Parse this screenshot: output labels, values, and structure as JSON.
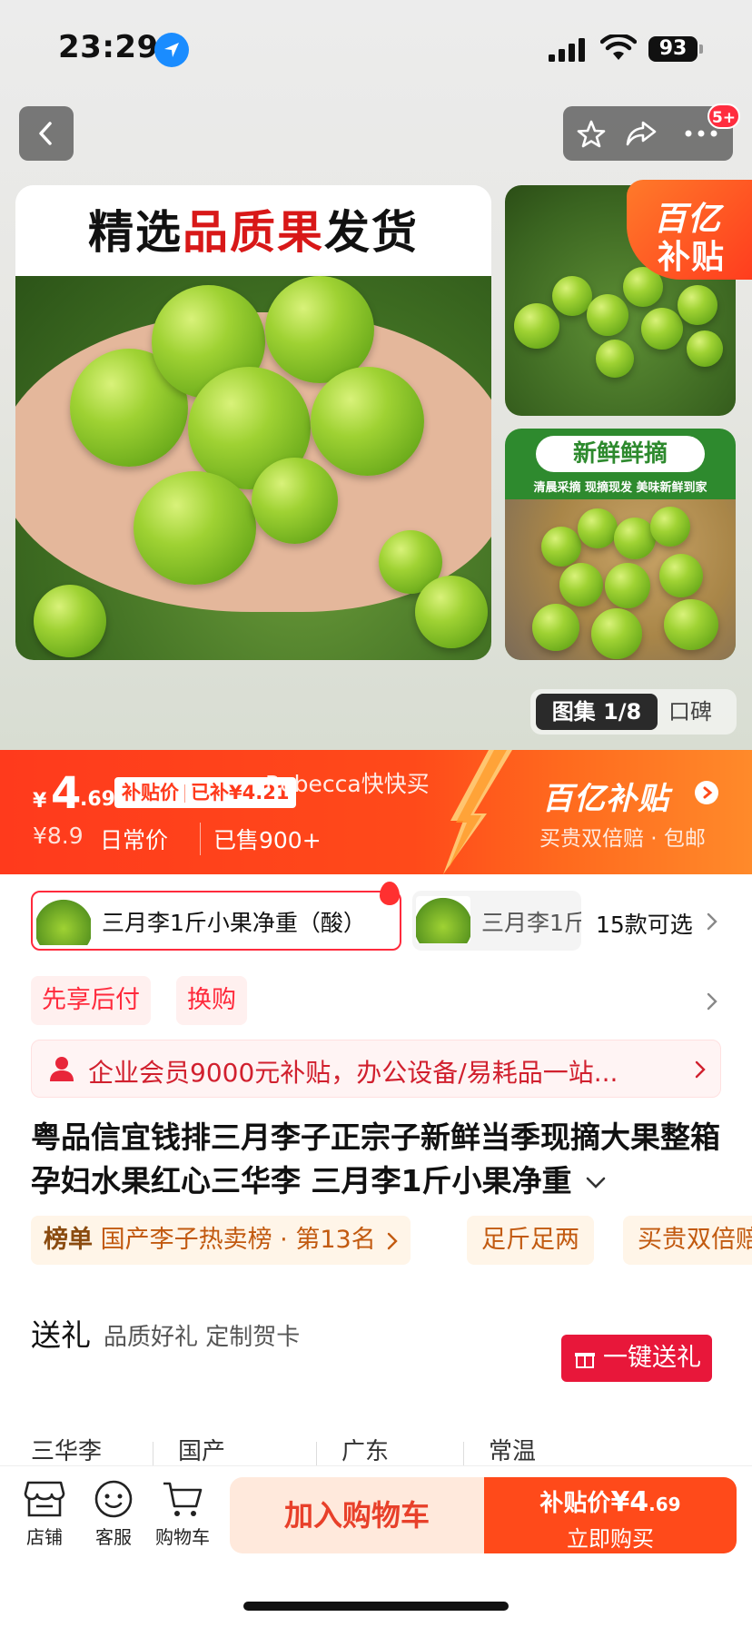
{
  "status_bar": {
    "time": "23:29",
    "battery": "93"
  },
  "header": {
    "notification_badge": "5+"
  },
  "gallery": {
    "main_headline_part1": "精选",
    "main_headline_red": "品质果",
    "main_headline_part2": "发货",
    "corner_tag_line1": "百亿",
    "corner_tag_line2": "补贴",
    "side_pill": "新鲜鲜摘",
    "side_sub": "清晨采摘 现摘现发 美味新鲜到家",
    "counter_active": "图集 1/8",
    "counter_other": "口碑"
  },
  "price": {
    "currency": "¥",
    "big": "4",
    "small": ".69",
    "tag_label": "补贴价",
    "tag_saved": "已补¥4.21",
    "watermark": "Rebecca快快买",
    "original_price": "¥8.9",
    "daily_label": "日常价",
    "sold": "已售900+",
    "brand": "百亿补贴",
    "brand_sub": "买贵双倍赔 · 包邮"
  },
  "variants": {
    "selected": "三月李1斤小果净重（酸）",
    "second": "三月李1斤",
    "count": "15款可选"
  },
  "tags": [
    "先享后付",
    "换购"
  ],
  "member_bar": {
    "text": "企业会员9000元补贴，办公设备/易耗品一站..."
  },
  "title": "粤品信宜钱排三月李子正宗子新鲜当季现摘大果整箱孕妇水果红心三华李 三月李1斤小果净重",
  "ranking": {
    "key": "榜单",
    "value": "国产李子热卖榜 · 第13名"
  },
  "extra_tags": [
    "足斤足两",
    "买贵双倍赔"
  ],
  "gift": {
    "title": "送礼",
    "subtitle": "品质好礼 定制贺卡",
    "button": "一键送礼"
  },
  "attributes": [
    "三华李",
    "国产",
    "广东",
    "常温"
  ],
  "bottom_bar": {
    "nav": [
      "店铺",
      "客服",
      "购物车"
    ],
    "add_to_cart": "加入购物车",
    "buy_label": "补贴价",
    "buy_price_big": "¥4",
    "buy_price_small": ".69",
    "buy_now": "立即购买"
  },
  "colors": {
    "accent": "#ff4a1a",
    "red": "#ff2a3c",
    "brand_orange": "#ff6a1e"
  }
}
